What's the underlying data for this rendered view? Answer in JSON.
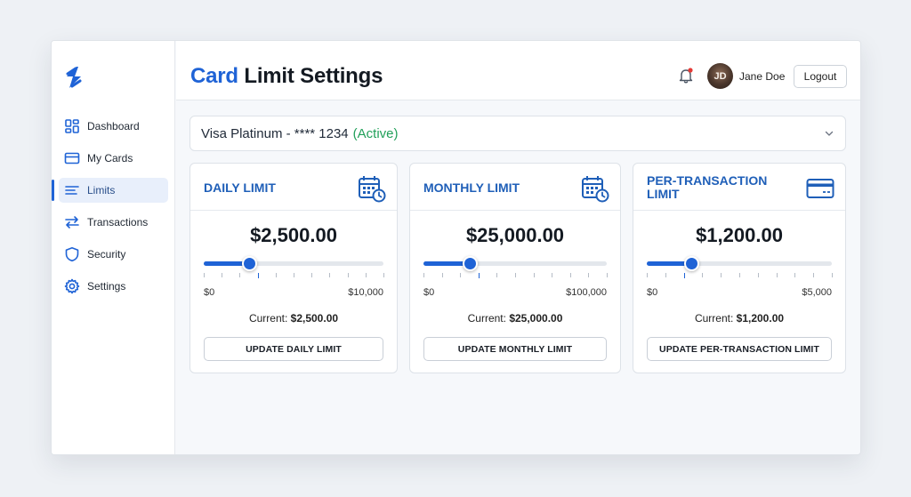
{
  "app": {
    "accent_color": "#1f63d6",
    "status_color": "#22a05a"
  },
  "sidebar": {
    "logo_icon": "lightning-bolt-logo",
    "items": [
      {
        "label": "Dashboard",
        "icon": "dashboard-icon",
        "active": false
      },
      {
        "label": "My Cards",
        "icon": "credit-card-icon",
        "active": false
      },
      {
        "label": "Limits",
        "icon": "list-lines-icon",
        "active": true
      },
      {
        "label": "Transactions",
        "icon": "swap-arrows-icon",
        "active": false
      },
      {
        "label": "Security",
        "icon": "shield-icon",
        "active": false
      },
      {
        "label": "Settings",
        "icon": "gear-icon",
        "active": false
      }
    ]
  },
  "header": {
    "title_accent": "Card",
    "title_rest": "Limit Settings",
    "notification_icon": "bell-icon",
    "avatar_initials": "JD",
    "user_name": "Jane Doe",
    "logout_label": "Logout"
  },
  "card_select": {
    "value": "Visa Platinum - **** 1234",
    "status": "(Active)",
    "icon": "chevron-down-icon"
  },
  "limits": [
    {
      "title": "DAILY LIMIT",
      "icon": "calendar-clock-icon",
      "amount": "$2,500.00",
      "min_label": "$0",
      "max_label": "$10,000",
      "value_fraction": 0.25,
      "current_label": "Current:",
      "current_value": "$2,500.00",
      "button_label": "UPDATE DAILY LIMIT"
    },
    {
      "title": "MONTHLY LIMIT",
      "icon": "calendar-clock-icon",
      "amount": "$25,000.00",
      "min_label": "$0",
      "max_label": "$100,000",
      "value_fraction": 0.25,
      "current_label": "Current:",
      "current_value": "$25,000.00",
      "button_label": "UPDATE MONTHLY LIMIT"
    },
    {
      "title": "PER-TRANSACTION LIMIT",
      "icon": "credit-card-icon",
      "amount": "$1,200.00",
      "min_label": "$0",
      "max_label": "$5,000",
      "value_fraction": 0.24,
      "current_label": "Current:",
      "current_value": "$1,200.00",
      "button_label": "UPDATE PER-TRANSACTION LIMIT"
    }
  ]
}
